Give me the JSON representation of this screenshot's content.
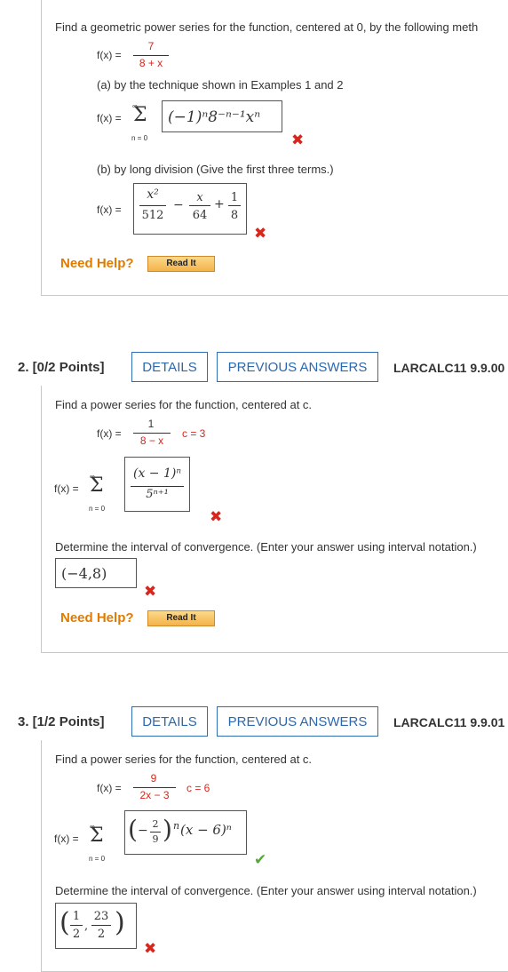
{
  "q1": {
    "prompt": "Find a geometric power series for the function, centered at 0, by the following meth",
    "fx_label": "f(x) =",
    "fx_num": "7",
    "fx_den": "8 + x",
    "part_a": "(a) by the technique shown in Examples 1 and 2",
    "sum_top": "∞",
    "sum_bot": "n = 0",
    "answer_a": "(−1)ⁿ8⁻ⁿ⁻¹xⁿ",
    "part_b": "(b) by long division (Give the first three terms.)",
    "b_t1_num": "x²",
    "b_t1_den": "512",
    "b_minus": "−",
    "b_t2_num": "x",
    "b_t2_den": "64",
    "b_plus": "+",
    "b_t3_num": "1",
    "b_t3_den": "8",
    "need_help": "Need Help?",
    "read_it": "Read It"
  },
  "q2": {
    "header": "2.  [0/2 Points]",
    "details": "DETAILS",
    "previous": "PREVIOUS ANSWERS",
    "ref": "LARCALC11 9.9.00",
    "prompt": "Find a power series for the function, centered at c.",
    "fx_label": "f(x) =",
    "fx_num": "1",
    "fx_den": "8 − x",
    "c_label": "c = 3",
    "sum_top": "∞",
    "sum_bot": "n = 0",
    "ans_num": "(x − 1)ⁿ",
    "ans_den": "5ⁿ⁺¹",
    "interval_prompt": "Determine the interval of convergence. (Enter your answer using interval notation.)",
    "interval_answer": "(−4,8)",
    "need_help": "Need Help?",
    "read_it": "Read It"
  },
  "q3": {
    "header": "3.  [1/2 Points]",
    "details": "DETAILS",
    "previous": "PREVIOUS ANSWERS",
    "ref": "LARCALC11 9.9.01",
    "prompt": "Find a power series for the function, centered at c.",
    "fx_label": "f(x) =",
    "fx_num": "9",
    "fx_den": "2x − 3",
    "c_label": "c = 6",
    "sum_top": "∞",
    "sum_bot": "n = 0",
    "ans_frac_num": "2",
    "ans_frac_den": "9",
    "ans_tail": "(x − 6)ⁿ",
    "interval_prompt": "Determine the interval of convergence. (Enter your answer using interval notation.)",
    "int_a_num": "1",
    "int_a_den": "2",
    "int_b_num": "23",
    "int_b_den": "2"
  },
  "icons": {
    "wrong": "✖",
    "correct": "✔"
  },
  "colors": {
    "wrong": "#d9261c",
    "correct": "#5aa63e",
    "link": "#2c68ad",
    "help": "#e07b00"
  }
}
